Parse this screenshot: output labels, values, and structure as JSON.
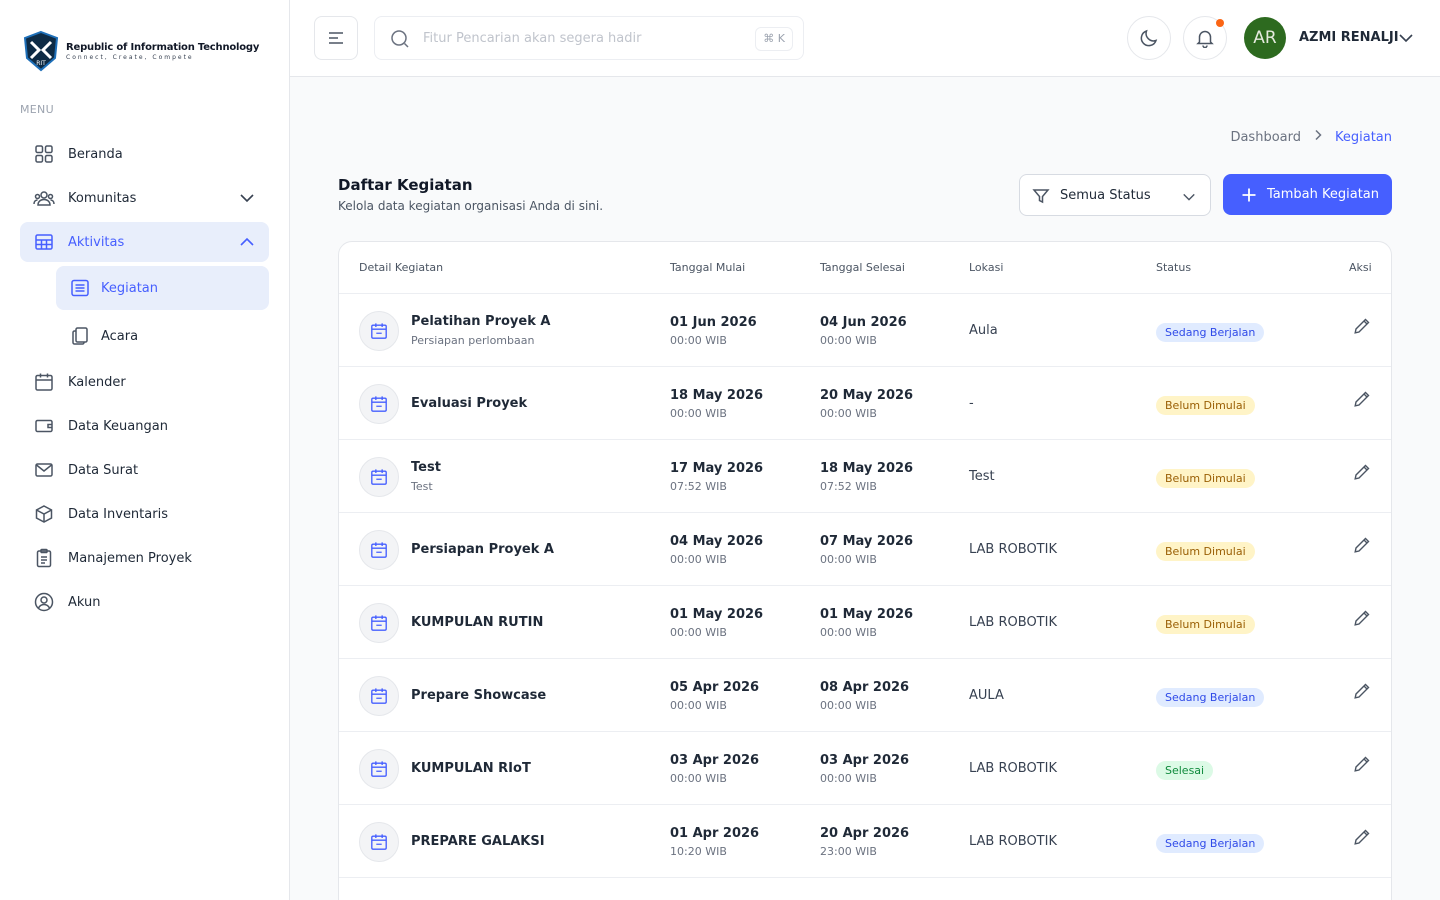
{
  "brand": {
    "title": "Republic of Information Technology",
    "tagline": "Connect, Create, Compete",
    "logo_letters": "RIT"
  },
  "sidebar": {
    "menu_label": "MENU",
    "items": [
      {
        "label": "Beranda",
        "icon": "grid-icon"
      },
      {
        "label": "Komunitas",
        "icon": "users-icon"
      },
      {
        "label": "Aktivitas",
        "icon": "table-icon"
      },
      {
        "label": "Kegiatan",
        "icon": "list-icon"
      },
      {
        "label": "Acara",
        "icon": "copy-icon"
      },
      {
        "label": "Kalender",
        "icon": "calendar-icon"
      },
      {
        "label": "Data Keuangan",
        "icon": "wallet-icon"
      },
      {
        "label": "Data Surat",
        "icon": "mail-icon"
      },
      {
        "label": "Data Inventaris",
        "icon": "box-icon"
      },
      {
        "label": "Manajemen Proyek",
        "icon": "clipboard-icon"
      },
      {
        "label": "Akun",
        "icon": "user-circle-icon"
      }
    ]
  },
  "header": {
    "search_placeholder": "Fitur Pencarian akan segera hadir",
    "search_shortcut": "⌘ K",
    "user_initials": "AR",
    "user_name": "AZMI RENALJI"
  },
  "breadcrumb": {
    "parent": "Dashboard",
    "current": "Kegiatan"
  },
  "page": {
    "title": "Daftar Kegiatan",
    "subtitle": "Kelola data kegiatan organisasi Anda di sini.",
    "filter_label": "Semua Status",
    "add_button": "Tambah Kegiatan"
  },
  "table": {
    "columns": [
      "Detail Kegiatan",
      "Tanggal Mulai",
      "Tanggal Selesai",
      "Lokasi",
      "Status",
      "Aksi"
    ],
    "rows": [
      {
        "title": "Pelatihan Proyek A",
        "desc": "Persiapan perlombaan",
        "start_date": "01 Jun 2026",
        "start_time": "00:00 WIB",
        "end_date": "04 Jun 2026",
        "end_time": "00:00 WIB",
        "location": "Aula",
        "status": "Sedang Berjalan",
        "status_color": "blue"
      },
      {
        "title": "Evaluasi Proyek",
        "desc": "",
        "start_date": "18 May 2026",
        "start_time": "00:00 WIB",
        "end_date": "20 May 2026",
        "end_time": "00:00 WIB",
        "location": "-",
        "status": "Belum Dimulai",
        "status_color": "yellow"
      },
      {
        "title": "Test",
        "desc": "Test",
        "start_date": "17 May 2026",
        "start_time": "07:52 WIB",
        "end_date": "18 May 2026",
        "end_time": "07:52 WIB",
        "location": "Test",
        "status": "Belum Dimulai",
        "status_color": "yellow"
      },
      {
        "title": "Persiapan Proyek A",
        "desc": "",
        "start_date": "04 May 2026",
        "start_time": "00:00 WIB",
        "end_date": "07 May 2026",
        "end_time": "00:00 WIB",
        "location": "LAB ROBOTIK",
        "status": "Belum Dimulai",
        "status_color": "yellow"
      },
      {
        "title": "KUMPULAN RUTIN",
        "desc": "",
        "start_date": "01 May 2026",
        "start_time": "00:00 WIB",
        "end_date": "01 May 2026",
        "end_time": "00:00 WIB",
        "location": "LAB ROBOTIK",
        "status": "Belum Dimulai",
        "status_color": "yellow"
      },
      {
        "title": "Prepare Showcase",
        "desc": "",
        "start_date": "05 Apr 2026",
        "start_time": "00:00 WIB",
        "end_date": "08 Apr 2026",
        "end_time": "00:00 WIB",
        "location": "AULA",
        "status": "Sedang Berjalan",
        "status_color": "blue"
      },
      {
        "title": "KUMPULAN RIoT",
        "desc": "",
        "start_date": "03 Apr 2026",
        "start_time": "00:00 WIB",
        "end_date": "03 Apr 2026",
        "end_time": "00:00 WIB",
        "location": "LAB ROBOTIK",
        "status": "Selesai",
        "status_color": "green"
      },
      {
        "title": "PREPARE GALAKSI",
        "desc": "",
        "start_date": "01 Apr 2026",
        "start_time": "10:20 WIB",
        "end_date": "20 Apr 2026",
        "end_time": "23:00 WIB",
        "location": "LAB ROBOTIK",
        "status": "Sedang Berjalan",
        "status_color": "blue"
      }
    ]
  }
}
